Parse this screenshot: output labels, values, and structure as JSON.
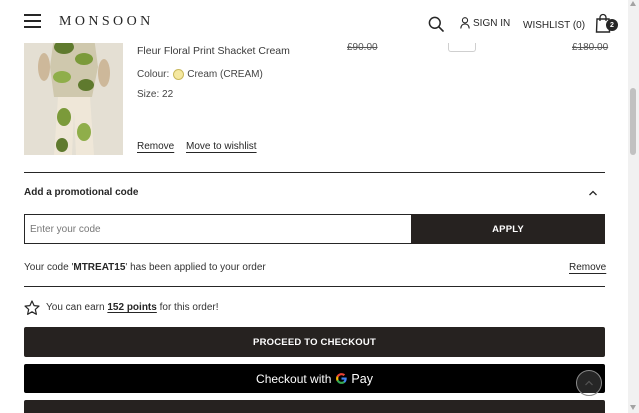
{
  "header": {
    "logo": "MONSOON",
    "sign_in": "SIGN IN",
    "wishlist": "WISHLIST (0)",
    "bag_count": "2"
  },
  "product": {
    "name": "Fleur Floral Print Shacket Cream",
    "colour_label": "Colour:",
    "colour_value": "Cream (CREAM)",
    "size": "Size: 22",
    "old_price": "£90.00",
    "old_total": "£180.00",
    "remove": "Remove",
    "move_to_wishlist": "Move to wishlist"
  },
  "promo": {
    "header": "Add a promotional code",
    "placeholder": "Enter your code",
    "apply": "APPLY",
    "applied_prefix": "Your code '",
    "applied_code": "MTREAT15",
    "applied_suffix": "' has been applied to your order",
    "remove": "Remove"
  },
  "points": {
    "prefix": "You can earn",
    "link": "152 points",
    "suffix": "for this order!"
  },
  "checkout": {
    "proceed": "PROCEED TO CHECKOUT",
    "gpay_prefix": "Checkout with",
    "gpay_pay": "Pay"
  },
  "colors": {
    "primary_dark": "#262220",
    "swatch": "#f5e8a0"
  }
}
